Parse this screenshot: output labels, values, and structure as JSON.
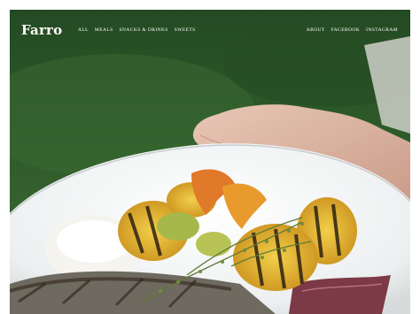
{
  "site": {
    "logo": "Farro"
  },
  "nav": {
    "left": [
      "ALL",
      "MEALS",
      "SNACKS & DRINKS",
      "SWEETS"
    ],
    "right": [
      "ABOUT",
      "FACEBOOK",
      "INSTAGRAM"
    ]
  },
  "hero": {
    "image_subject": "hand holding plate of grilled squash, zucchini and peppers with thyme over rice and grilled fish"
  },
  "colors": {
    "background": "#2f5a2a",
    "text": "#ffffff"
  }
}
